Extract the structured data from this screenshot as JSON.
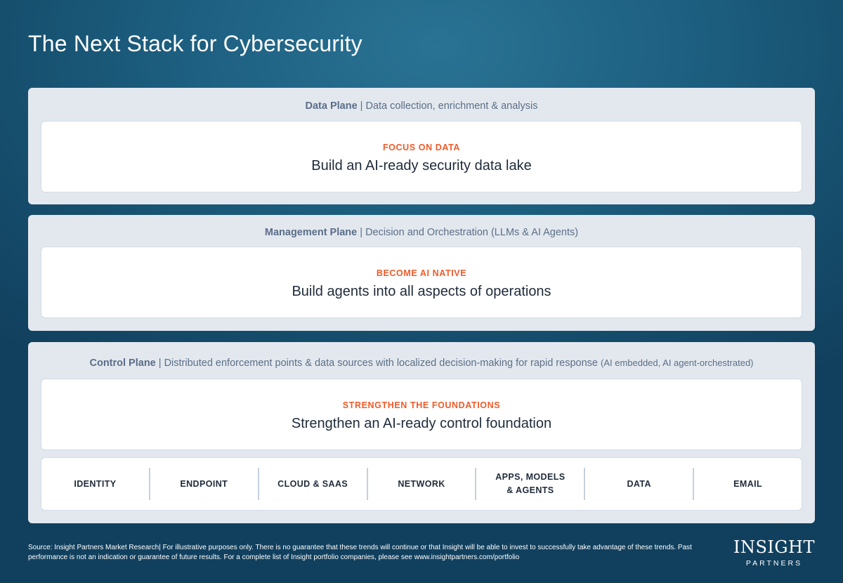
{
  "title": "The Next Stack for Cybersecurity",
  "planes": [
    {
      "name": "Data Plane",
      "separator": " | ",
      "description": "Data collection, enrichment & analysis",
      "tag": "FOCUS ON DATA",
      "statement": "Build an AI-ready security data lake"
    },
    {
      "name": "Management Plane",
      "separator": " | ",
      "description": "Decision and Orchestration (LLMs & AI Agents)",
      "tag": "BECOME AI NATIVE",
      "statement": "Build agents into all aspects of operations"
    },
    {
      "name": "Control Plane",
      "separator": " | ",
      "description": "Distributed enforcement points & data sources with localized decision-making for rapid response ",
      "description_note": "(AI embedded, AI agent-orchestrated)",
      "tag": "STRENGTHEN THE FOUNDATIONS",
      "statement": "Strengthen an AI-ready control foundation"
    }
  ],
  "foundations": [
    "IDENTITY",
    "ENDPOINT",
    "CLOUD & SAAS",
    "NETWORK",
    "APPS, MODELS\n& AGENTS",
    "DATA",
    "EMAIL"
  ],
  "footnote": "Source: Insight Partners Market  Research| For illustrative purposes only. There is no guarantee that these trends will continue or that Insight will be able to invest to successfully take advantage of these trends. Past performance is not an indication or guarantee of future results. For a complete list of Insight portfolio companies, please see www.insightpartners.com/portfolio",
  "brand": {
    "wordmark": "INSIGHT",
    "sub": "PARTNERS"
  }
}
